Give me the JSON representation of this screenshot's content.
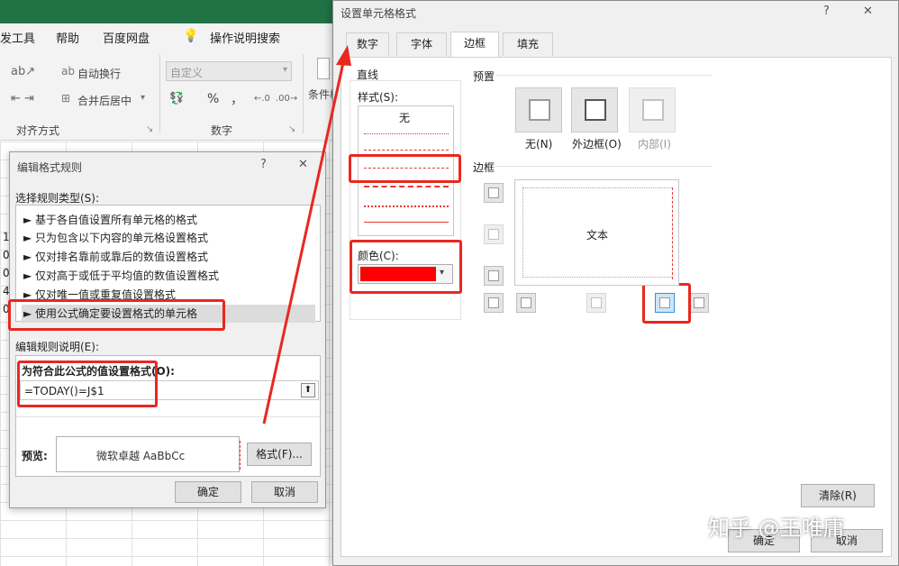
{
  "ribbon": {
    "tabs": [
      "发工具",
      "帮助",
      "百度网盘",
      "操作说明搜索"
    ],
    "wrap_text": "自动换行",
    "merge_center": "合并后居中",
    "number_format": "自定义",
    "percent": "%",
    "comma": "，",
    "cond_format": "条件格",
    "group_alignment": "对齐方式",
    "group_number": "数字"
  },
  "sheet": {
    "row_numbers": [
      "1",
      "0",
      "0",
      "4",
      "0"
    ]
  },
  "rule_dialog": {
    "title": "编辑格式规则",
    "help": "?",
    "close": "✕",
    "select_type_label": "选择规则类型(S):",
    "rule_types": [
      "► 基于各自值设置所有单元格的格式",
      "► 只为包含以下内容的单元格设置格式",
      "► 仅对排名靠前或靠后的数值设置格式",
      "► 仅对高于或低于平均值的数值设置格式",
      "► 仅对唯一值或重复值设置格式",
      "► 使用公式确定要设置格式的单元格"
    ],
    "edit_desc_label": "编辑规则说明(E):",
    "formula_label": "为符合此公式的值设置格式(O):",
    "formula_value": "=TODAY()=J$1",
    "preview_label": "预览:",
    "preview_text": "微软卓越  AaBbCc",
    "format_button": "格式(F)...",
    "ok": "确定",
    "cancel": "取消"
  },
  "cell_dialog": {
    "title": "设置单元格格式",
    "help": "?",
    "close": "✕",
    "tabs": [
      "数字",
      "字体",
      "边框",
      "填充"
    ],
    "line_group": "直线",
    "style_label": "样式(S):",
    "style_none": "无",
    "color_label": "颜色(C):",
    "color_value": "#ff0000",
    "presets_group": "预置",
    "preset_labels": [
      "无(N)",
      "外边框(O)",
      "内部(I)"
    ],
    "border_group": "边框",
    "preview_text": "文本",
    "clear_button": "清除(R)",
    "ok": "确定",
    "cancel": "取消"
  },
  "watermark": "知乎 @王唯庸",
  "colors": {
    "excel_green": "#217346",
    "annotation_red": "#e8281f"
  }
}
